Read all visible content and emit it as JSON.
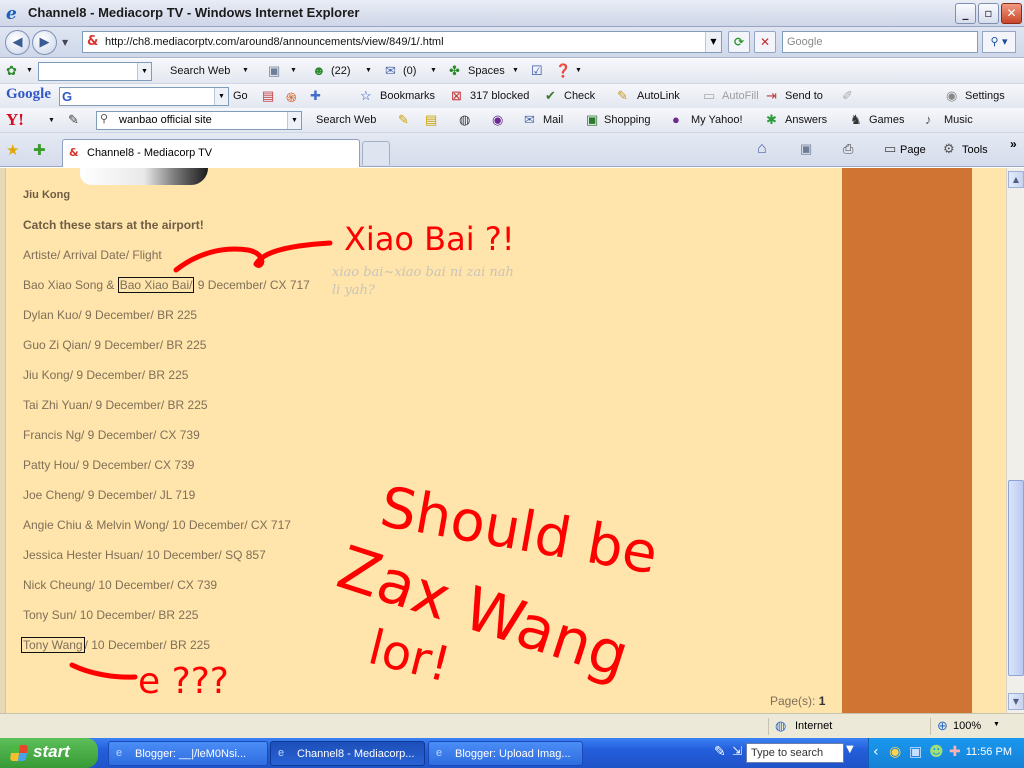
{
  "window": {
    "title": "Channel8 - Mediacorp TV - Windows Internet Explorer",
    "minimize": "_",
    "maximize": "▫",
    "close": "✕"
  },
  "address": {
    "url": "http://ch8.mediacorptv.com/around8/announcements/view/849/1/.html"
  },
  "search": {
    "placeholder": "Google"
  },
  "toolbar1": {
    "search_web": "Search Web",
    "mail_count": "(22)",
    "inbox_count": "(0)",
    "spaces": "Spaces"
  },
  "toolbar2": {
    "google": "Google",
    "go": "Go",
    "bookmarks": "Bookmarks",
    "blocked": "317 blocked",
    "check": "Check",
    "autolink": "AutoLink",
    "autofill": "AutoFill",
    "send_to": "Send to",
    "settings": "Settings"
  },
  "toolbar3": {
    "yahoo_search_value": "wanbao official site",
    "search_web": "Search Web",
    "mail": "Mail",
    "shopping": "Shopping",
    "my_yahoo": "My Yahoo!",
    "answers": "Answers",
    "games": "Games",
    "music": "Music"
  },
  "tab": {
    "label": "Channel8 - Mediacorp TV"
  },
  "commandbar": {
    "page": "Page",
    "tools": "Tools"
  },
  "page": {
    "caption": "Jiu Kong",
    "heading": "Catch these stars at the airport!",
    "col_header": "Artiste/ Arrival Date/ Flight",
    "first_prefix": "Bao Xiao Song & ",
    "first_boxed": "Bao Xiao Bai/",
    "first_suffix": " 9 December/ CX 717",
    "rows": [
      "Dylan Kuo/ 9 December/ BR 225",
      "Guo Zi Qian/ 9 December/ BR 225",
      "Jiu Kong/ 9 December/ BR 225",
      "Tai Zhi Yuan/ 9 December/ BR 225",
      "Francis Ng/ 9 December/ CX 739",
      "Patty Hou/ 9 December/ CX 739",
      "Joe Cheng/ 9 December/ JL 719",
      "Angie Chiu & Melvin Wong/ 10 December/ CX 717",
      "Jessica Hester Hsuan/ 10 December/ SQ 857",
      "Nick Cheung/ 10 December/ CX 739",
      "Tony Sun/ 10 December/ BR 225"
    ],
    "last_boxed": "Tony Wang",
    "last_suffix": "/ 10 December/ BR 225",
    "pages_label": "Page(s): ",
    "pages_value": "1",
    "note_line1": "xiao bai~xiao bai ni zai nah",
    "note_line2": "li yah?"
  },
  "annotations": {
    "color": "#ff0000",
    "xiao_bai": "Xiao Bai ?!",
    "should_be": "Should be",
    "zax_wang": "Zax Wang",
    "lor": "lor!",
    "e_qqq": "e ???"
  },
  "status": {
    "zone": "Internet",
    "zoom": "100%"
  },
  "taskbar": {
    "start": "start",
    "tasks": [
      "Blogger: __|/leM0Nsi...",
      "Channel8 - Mediacorp...",
      "Blogger: Upload Imag..."
    ],
    "search_placeholder": "Type to search",
    "clock": "11:56 PM"
  }
}
